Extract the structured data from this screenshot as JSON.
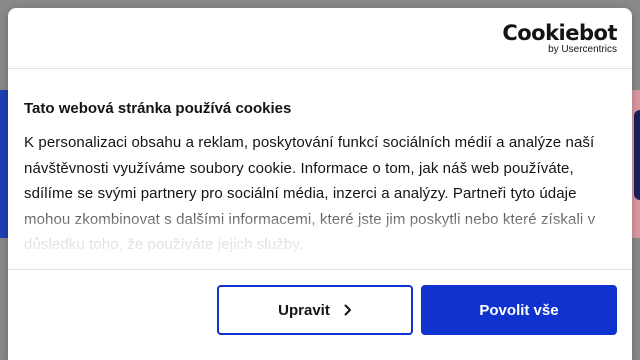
{
  "logo": {
    "brand": "Cookiebot",
    "sub": "by Usercentrics"
  },
  "dialog": {
    "title": "Tato webová stránka používá cookies",
    "body": "K personalizaci obsahu a reklam, poskytování funkcí sociálních médií a analýze naší návštěvnosti využíváme soubory cookie. Informace o tom, jak náš web používáte, sdílíme se svými partnery pro sociální média, inzerci a analýzy. Partneři tyto údaje mohou zkombinovat s dalšími informacemi, které jste jim poskytli nebo které získali v důsledku toho, že používáte jejich služby."
  },
  "buttons": {
    "customize_label": "Upravit",
    "allow_all_label": "Povolit vše"
  },
  "icons": {
    "customize": "chevron-right-icon"
  },
  "colors": {
    "accent": "#1032cf",
    "text": "#141414"
  }
}
